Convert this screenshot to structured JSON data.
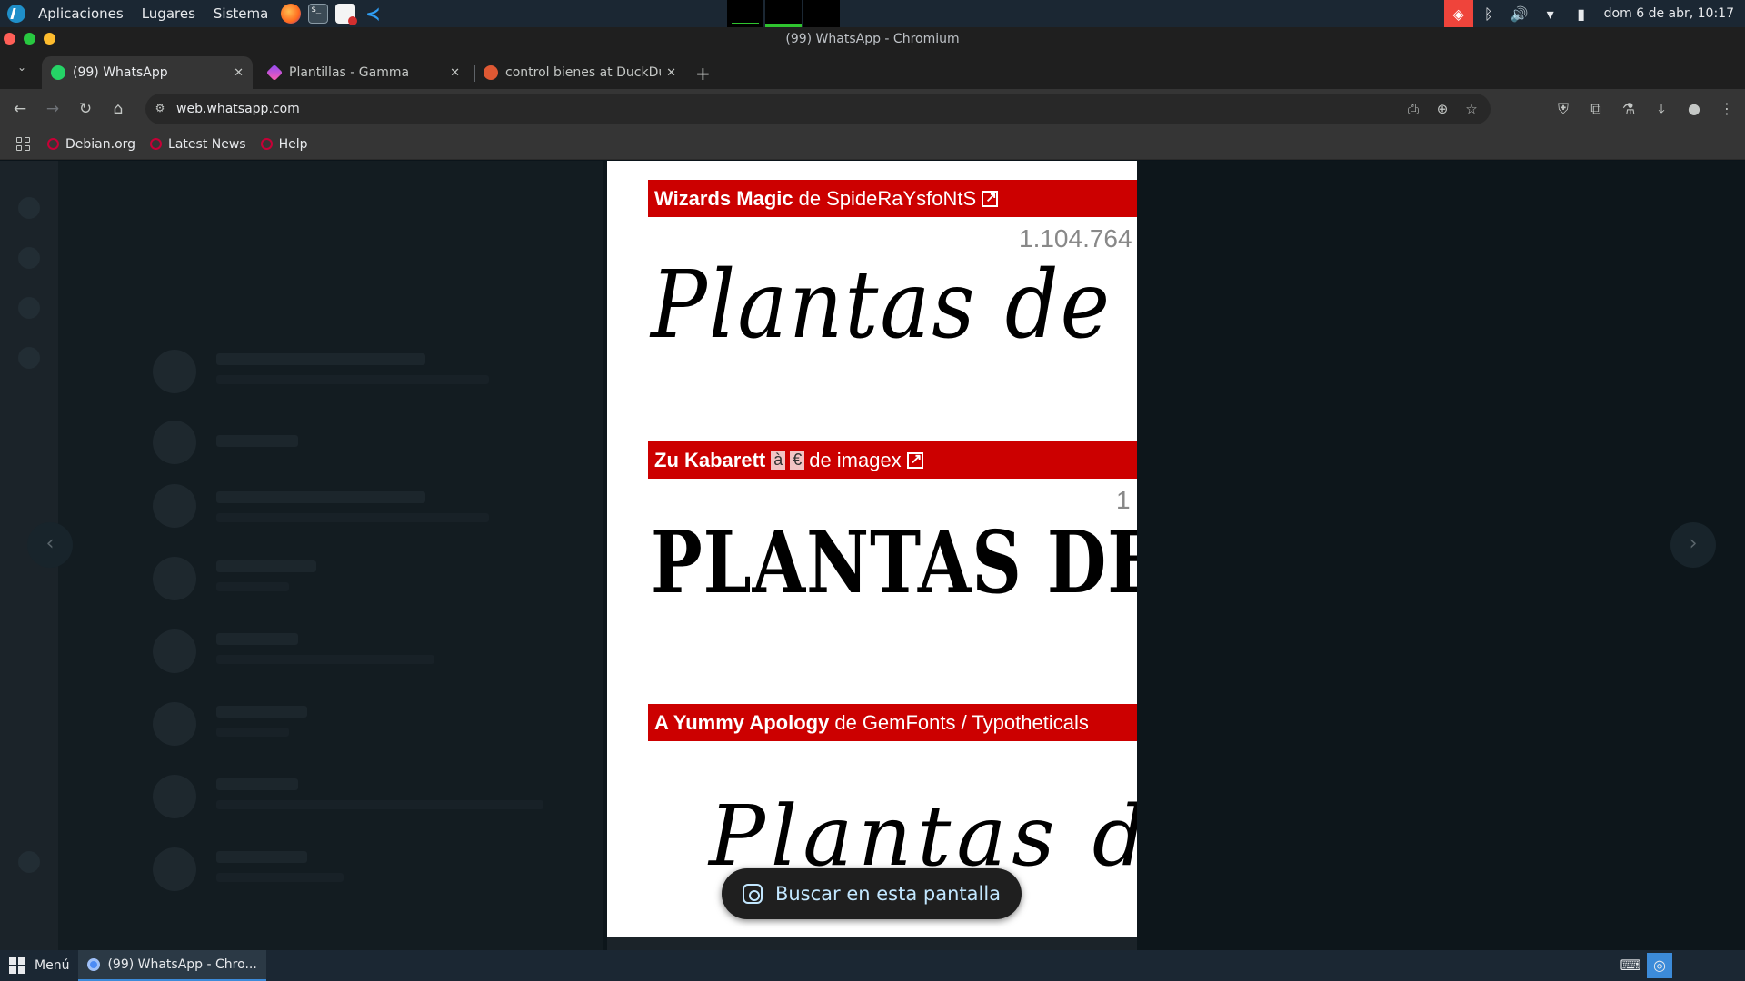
{
  "os_panel": {
    "menus": [
      "Aplicaciones",
      "Lugares",
      "Sistema"
    ],
    "launchers": [
      "firefox-icon",
      "terminal-icon",
      "document-icon",
      "vscode-icon"
    ],
    "clock": "dom 6 de abr, 10:17"
  },
  "window": {
    "title": "(99) WhatsApp - Chromium"
  },
  "tabs": [
    {
      "label": "(99) WhatsApp",
      "icon": "whatsapp-icon",
      "active": true
    },
    {
      "label": "Plantillas - Gamma",
      "icon": "gamma-icon",
      "active": false
    },
    {
      "label": "control bienes at DuckDu",
      "icon": "duckduckgo-icon",
      "active": false
    }
  ],
  "omnibox": {
    "url": "web.whatsapp.com"
  },
  "bookmarks": [
    {
      "label": "Debian.org"
    },
    {
      "label": "Latest News"
    },
    {
      "label": "Help"
    }
  ],
  "media_viewer": {
    "fonts": [
      {
        "name": "Wizards Magic",
        "by": "de",
        "author": "SpideRaYsfoNtS",
        "downloads": "1.104.764",
        "preview": "Plantas de los"
      },
      {
        "name": "Zu Kabarett",
        "glyphs": [
          "à",
          "€"
        ],
        "by": "de",
        "author": "imagex",
        "downloads": "1",
        "preview": "PLANTAS DE LOS"
      },
      {
        "name": "A Yummy Apology",
        "by": "de",
        "author": "GemFonts / Typotheticals",
        "preview": "Plantas de"
      }
    ],
    "lens_button": "Buscar en esta pantalla"
  },
  "taskbar": {
    "menu_label": "Menú",
    "task_label": "(99) WhatsApp - Chro..."
  },
  "colors": {
    "font_bar": "#cc0000",
    "os_panel": "#1b2733",
    "browser_frame": "#1f1f1f",
    "toolbar": "#353535",
    "whatsapp_bg": "#111b21"
  }
}
